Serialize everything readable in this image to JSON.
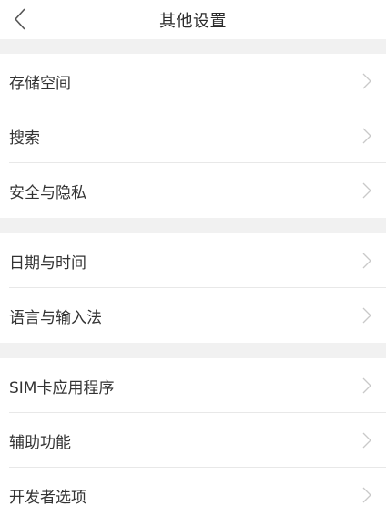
{
  "header": {
    "title": "其他设置",
    "back_icon": "chevron-left-icon"
  },
  "groups": [
    {
      "items": [
        {
          "label": "存储空间"
        },
        {
          "label": "搜索"
        },
        {
          "label": "安全与隐私"
        }
      ]
    },
    {
      "items": [
        {
          "label": "日期与时间"
        },
        {
          "label": "语言与输入法"
        }
      ]
    },
    {
      "items": [
        {
          "label": "SIM卡应用程序"
        },
        {
          "label": "辅助功能"
        },
        {
          "label": "开发者选项"
        }
      ]
    }
  ],
  "colors": {
    "section_gap": "#f1f1f1",
    "divider": "#e8e8e8",
    "chevron": "#c9c9c9"
  }
}
